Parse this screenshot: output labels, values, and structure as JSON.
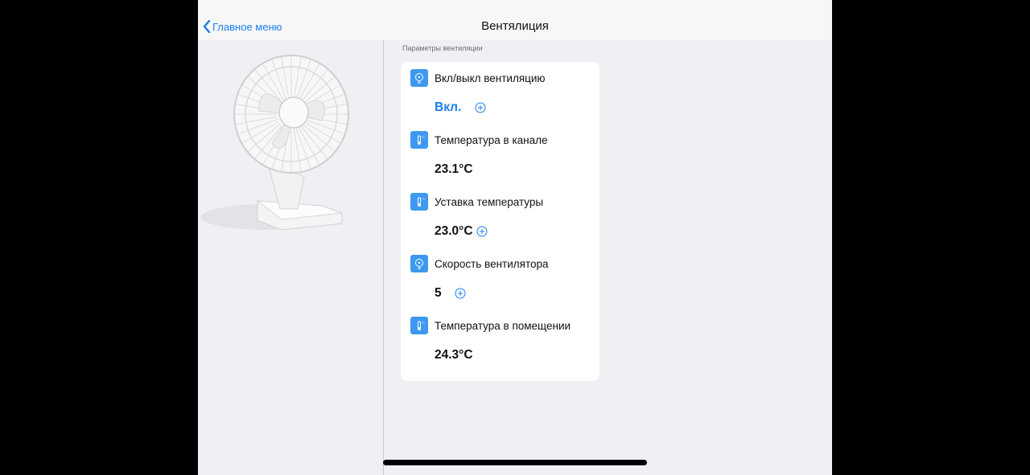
{
  "nav": {
    "back_label": "Главное меню",
    "title": "Вентялиция"
  },
  "section": {
    "header": "Параметры вентиляции"
  },
  "rows": [
    {
      "label": "Вкл/выкл вентиляцию",
      "value": "Вкл.",
      "editable": true,
      "icon": "fan-icon"
    },
    {
      "label": "Температура в канале",
      "value": "23.1°C",
      "editable": false,
      "icon": "thermometer-icon"
    },
    {
      "label": "Уставка температуры",
      "value": "23.0°C",
      "editable": true,
      "icon": "thermometer-icon"
    },
    {
      "label": "Скорость вентилятора",
      "value": "5",
      "editable": true,
      "icon": "fan-icon"
    },
    {
      "label": "Температура в помещении",
      "value": "24.3°C",
      "editable": false,
      "icon": "thermometer-icon"
    }
  ],
  "colors": {
    "accent": "#1a7ff0",
    "icon_bg": "#3d99ef",
    "background": "#efeff4",
    "card": "#ffffff"
  }
}
